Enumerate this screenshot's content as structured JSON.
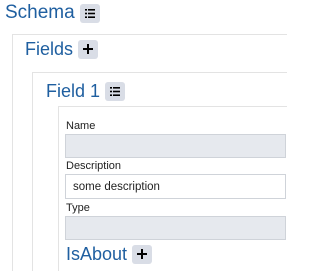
{
  "schema": {
    "title": "Schema",
    "menu_icon": "list-menu-icon"
  },
  "fields": {
    "title": "Fields",
    "add_icon": "plus-icon"
  },
  "field1": {
    "title": "Field 1",
    "menu_icon": "list-menu-icon",
    "name": {
      "label": "Name",
      "value": ""
    },
    "description": {
      "label": "Description",
      "value": "some description"
    },
    "type": {
      "label": "Type",
      "value": ""
    }
  },
  "isabout": {
    "title": "IsAbout",
    "add_icon": "plus-icon"
  }
}
